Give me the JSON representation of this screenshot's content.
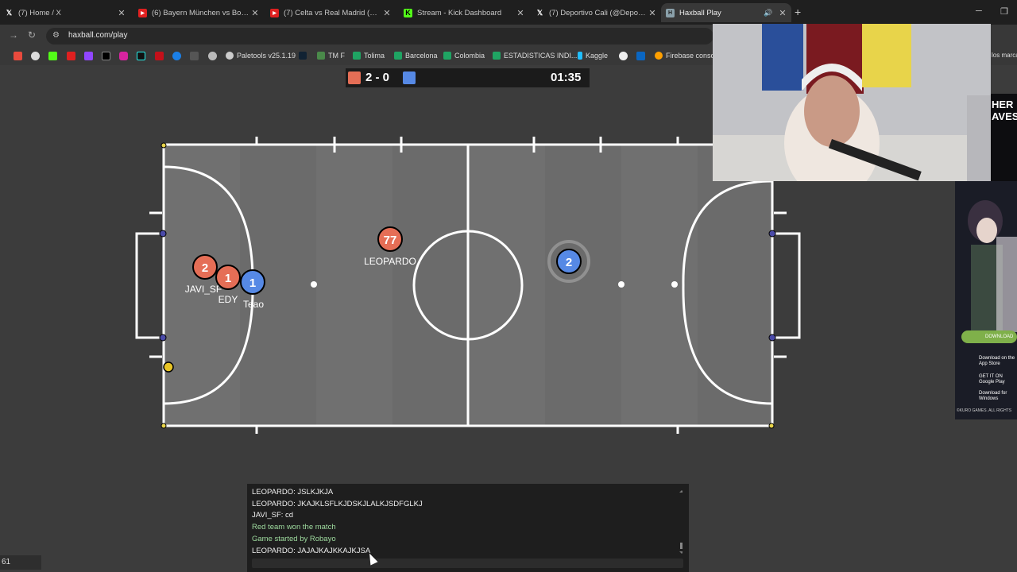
{
  "tabs": [
    {
      "title": "(7) Home / X",
      "icon": "x-icon"
    },
    {
      "title": "(6) Bayern München vs Borussi…",
      "icon": "youtube-icon"
    },
    {
      "title": "(7) Celta vs Real Madrid (1-2) |",
      "icon": "youtube-icon"
    },
    {
      "title": "Stream - Kick Dashboard",
      "icon": "kick-icon"
    },
    {
      "title": "(7) Deportivo Cali (@Deportivo…",
      "icon": "x-icon"
    },
    {
      "title": "Haxball Play",
      "icon": "haxball-icon"
    }
  ],
  "address": {
    "url": "haxball.com/play"
  },
  "bookmarks": [
    {
      "label": "Paletools v25.1.19"
    },
    {
      "label": "TM F"
    },
    {
      "label": "Tolima"
    },
    {
      "label": "Barcelona"
    },
    {
      "label": "Colombia"
    },
    {
      "label": "ESTADISTICAS INDI..."
    },
    {
      "label": "Kaggle"
    },
    {
      "label": "Firebase consol"
    },
    {
      "label": "los marca"
    }
  ],
  "scoreboard": {
    "score": "2 - 0",
    "timer": "01:35",
    "red_color": "#e56e56",
    "blue_color": "#5689e5"
  },
  "players": [
    {
      "number": "77",
      "name": "LEOPARDO",
      "team": "red"
    },
    {
      "number": "2",
      "name": "JAVI_SF",
      "team": "red"
    },
    {
      "number": "1",
      "name": "EDY",
      "team": "red"
    },
    {
      "number": "1",
      "name": "Teao",
      "team": "blue"
    },
    {
      "number": "2",
      "name": "",
      "team": "blue"
    }
  ],
  "chat": {
    "messages": [
      {
        "text": "LEOPARDO: JSLKJKJA",
        "system": false
      },
      {
        "text": "LEOPARDO: JKAJKLSFLKJDSKJLALKJSDFGLKJ",
        "system": false
      },
      {
        "text": "JAVI_SF: cd",
        "system": false
      },
      {
        "text": "Red team won the match",
        "system": true
      },
      {
        "text": "Game started by Robayo",
        "system": true
      },
      {
        "text": "LEOPARDO: JAJAJKAJKKAJKJSA",
        "system": false
      }
    ]
  },
  "fps": "61",
  "ad": {
    "headline": "HER AVES",
    "download_label": "DOWNLOAD",
    "store1": "Download on the App Store",
    "store2": "GET IT ON Google Play",
    "store3": "Download for Windows",
    "footer": "©KURO GAMES. ALL RIGHTS"
  }
}
